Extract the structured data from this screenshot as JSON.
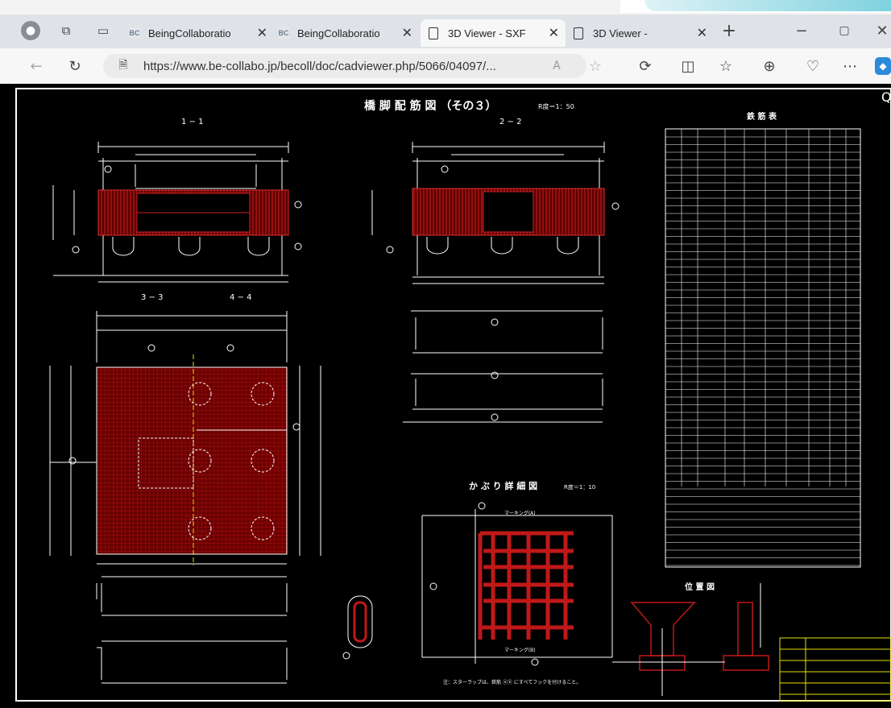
{
  "browser": {
    "tabs": [
      {
        "label": "BeingCollaboratio",
        "icon": "bc-icon"
      },
      {
        "label": "BeingCollaboratio",
        "icon": "bc-icon"
      },
      {
        "label": "3D Viewer - SXF",
        "icon": "document-icon"
      },
      {
        "label": "3D Viewer -",
        "icon": "document-icon"
      }
    ],
    "url": "https://www.be-collabo.jp/becoll/doc/cadviewer.php/5066/04097/...",
    "bc_badge": "BC"
  },
  "drawing": {
    "title": "橋 脚 配 筋 図 （その３）",
    "title_scale": "R度＝1：50",
    "sec_11": "1 − 1",
    "sec_22": "2 − 2",
    "sec_33": "3 − 3",
    "sec_44": "4 − 4",
    "rebar_table_title": "鉄 筋 表",
    "cover_detail_title": "か ぶ り 詳 細 図",
    "cover_detail_scale": "R度＝1：10",
    "location_title": "位 置 図",
    "note_bottom": "注：スターラップは、鉄筋 ⓐⓑ にすべてフックを付けること。",
    "marking_top": "マーキング(A)",
    "marking_bottom": "マーキング(B)"
  },
  "colors": {
    "rebar_red": "#8b0000",
    "line_white": "#ffffff",
    "dim_yellow": "#d8c800",
    "chrome_bg": "#f3f3f3"
  }
}
